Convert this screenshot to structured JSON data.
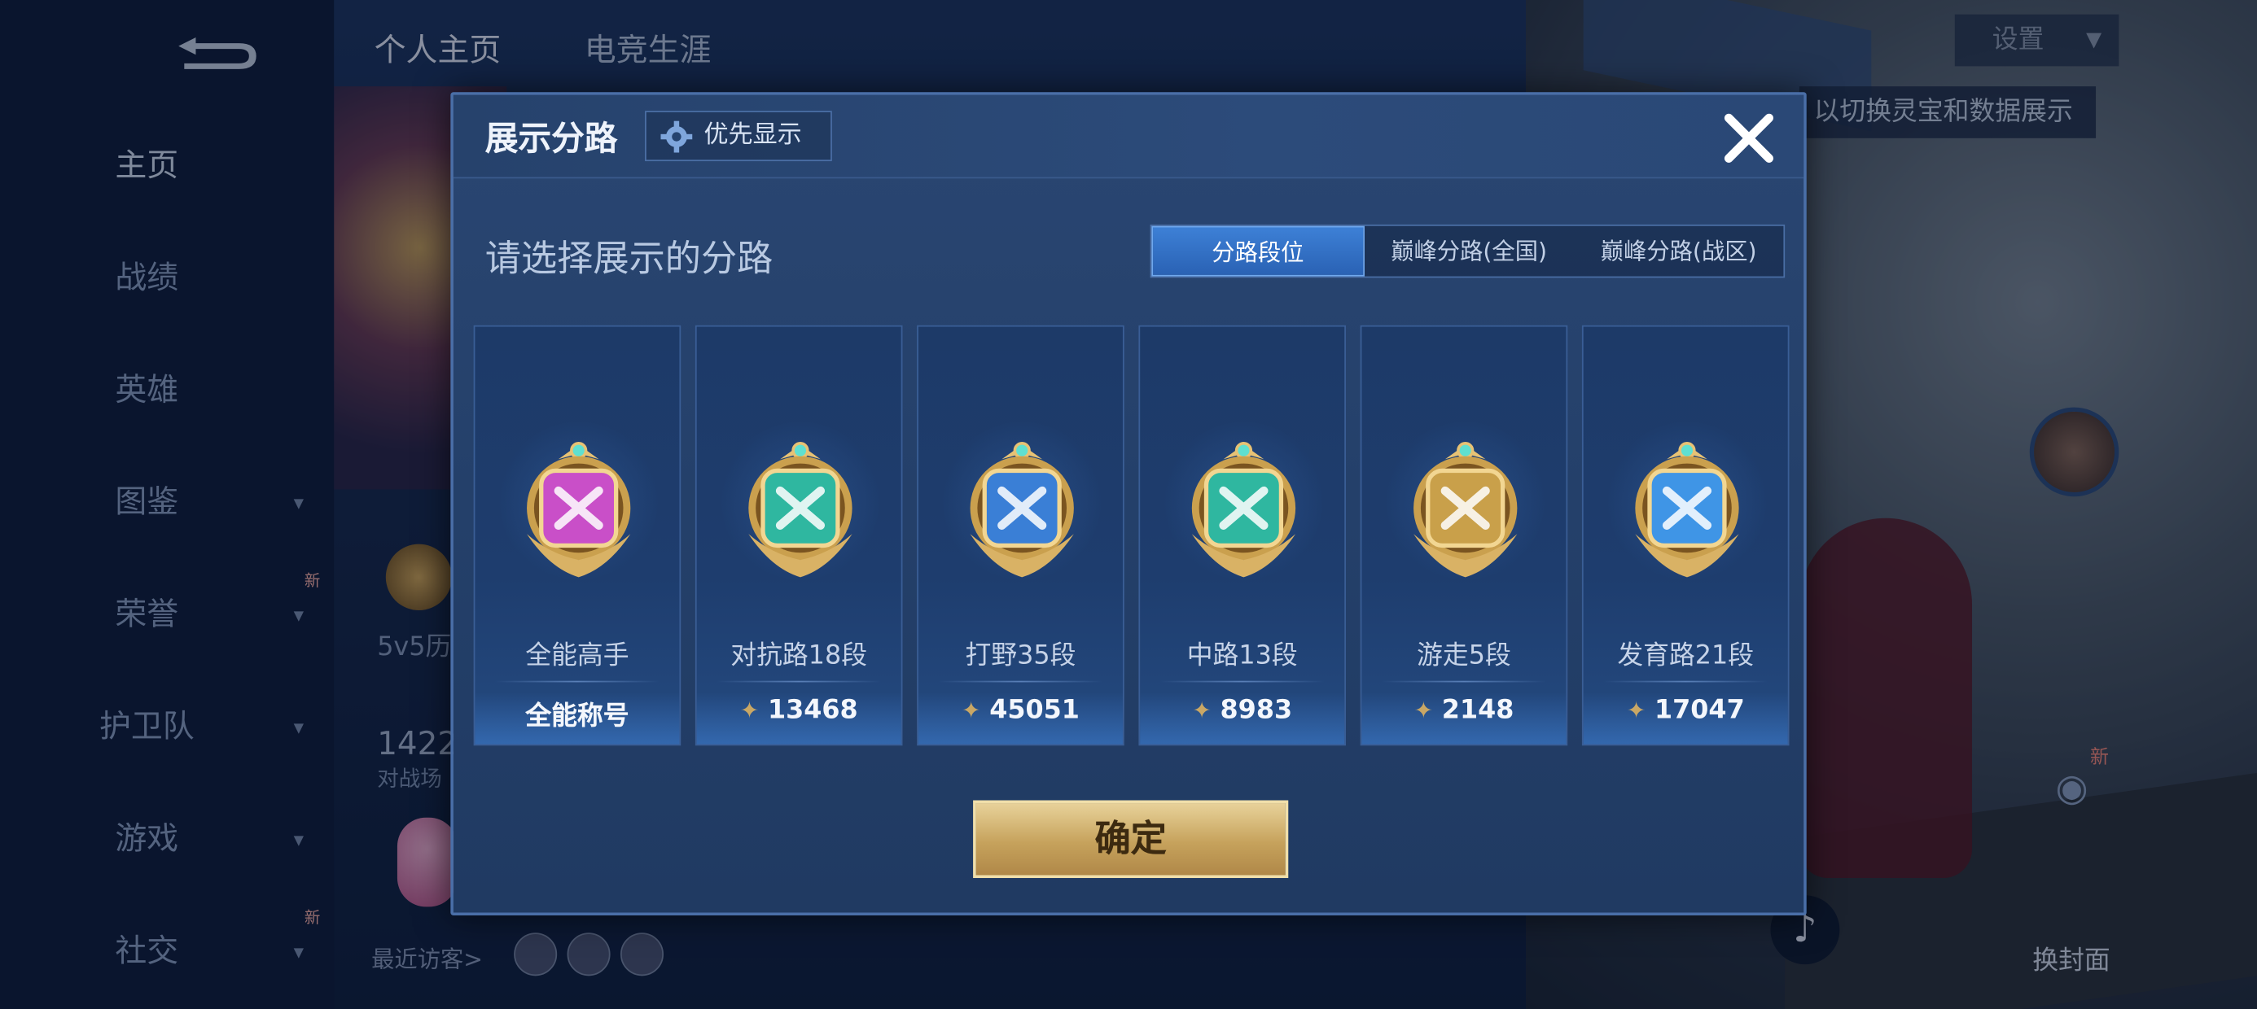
{
  "background": {
    "top_tabs": [
      "个人主页",
      "电竞生涯"
    ],
    "settings_label": "设置",
    "tip_text": "以切换灵宝和数据展示",
    "sidebar": [
      {
        "label": "主页",
        "chevron": false,
        "badge": ""
      },
      {
        "label": "战绩",
        "chevron": false,
        "badge": ""
      },
      {
        "label": "英雄",
        "chevron": false,
        "badge": ""
      },
      {
        "label": "图鉴",
        "chevron": true,
        "badge": ""
      },
      {
        "label": "荣誉",
        "chevron": true,
        "badge": "新"
      },
      {
        "label": "护卫队",
        "chevron": true,
        "badge": ""
      },
      {
        "label": "游戏",
        "chevron": true,
        "badge": ""
      },
      {
        "label": "社交",
        "chevron": true,
        "badge": "新"
      }
    ],
    "mid_label": "5v5历",
    "num_label": "1422",
    "num_sub": "对战场",
    "visitors_label": "最近访客>",
    "cover_label": "换封面",
    "camera_badge": "新"
  },
  "dialog": {
    "title": "展示分路",
    "priority_label": "优先显示",
    "prompt": "请选择展示的分路",
    "segments": [
      {
        "label": "分路段位",
        "active": true
      },
      {
        "label": "巅峰分路(全国)",
        "active": false
      },
      {
        "label": "巅峰分路(战区)",
        "active": false
      }
    ],
    "cards": [
      {
        "name": "全能高手",
        "stat": "全能称号",
        "has_icon": false,
        "badge": "all-round-badge-icon",
        "color": "#c94fc8"
      },
      {
        "name": "对抗路18段",
        "stat": "13468",
        "has_icon": true,
        "badge": "clash-lane-badge-icon",
        "color": "#2fb7a0"
      },
      {
        "name": "打野35段",
        "stat": "45051",
        "has_icon": true,
        "badge": "jungle-badge-icon",
        "color": "#3a7fd6"
      },
      {
        "name": "中路13段",
        "stat": "8983",
        "has_icon": true,
        "badge": "mid-lane-badge-icon",
        "color": "#2fb7a0"
      },
      {
        "name": "游走5段",
        "stat": "2148",
        "has_icon": true,
        "badge": "roam-badge-icon",
        "color": "#c9a04a"
      },
      {
        "name": "发育路21段",
        "stat": "17047",
        "has_icon": true,
        "badge": "farm-lane-badge-icon",
        "color": "#3f95e6"
      }
    ],
    "confirm_label": "确定"
  }
}
